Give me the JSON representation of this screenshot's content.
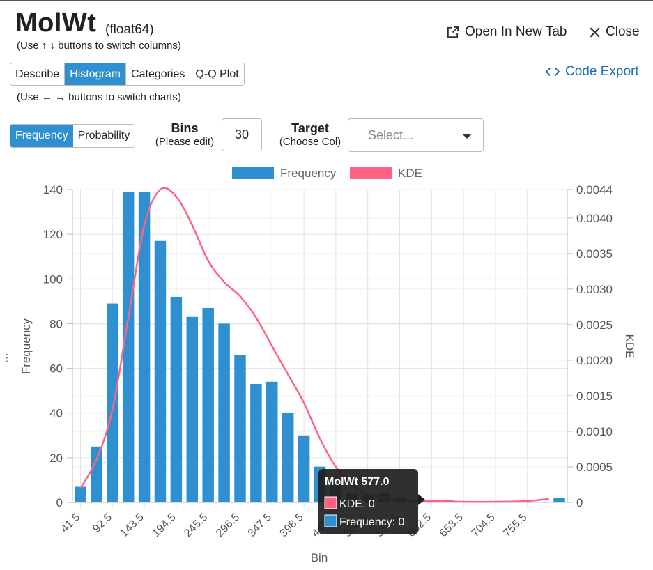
{
  "header": {
    "title": "MolWt",
    "dtype": "(float64)",
    "column_hint": "(Use ↑ ↓ buttons to switch columns)",
    "open_new_tab": "Open In New Tab",
    "close": "Close",
    "code_export": "Code Export"
  },
  "tabs": [
    {
      "label": "Describe",
      "active": false
    },
    {
      "label": "Histogram",
      "active": true
    },
    {
      "label": "Categories",
      "active": false
    },
    {
      "label": "Q-Q Plot",
      "active": false
    }
  ],
  "chart_hint": "(Use ← → buttons to switch charts)",
  "controls": {
    "mode_frequency": "Frequency",
    "mode_probability": "Probability",
    "bins_label": "Bins",
    "bins_sub": "(Please edit)",
    "bins_value": "30",
    "target_label": "Target",
    "target_sub": "(Choose Col)",
    "target_placeholder": "Select..."
  },
  "colors": {
    "accent": "#2e8fd1",
    "bar": "#2e8fd1",
    "kde": "#ff6384",
    "link": "#1f6db5",
    "tooltip_bg": "#1e1e1e"
  },
  "chart_data": {
    "type": "bar",
    "xlabel": "Bin",
    "ylabel": "Frequency",
    "y2label": "KDE",
    "ylim": [
      0,
      140
    ],
    "y2lim": [
      0,
      0.0044
    ],
    "yticks": [
      "0",
      "20",
      "40",
      "60",
      "80",
      "100",
      "120",
      "140"
    ],
    "y2ticks": [
      "0",
      "0.0005",
      "0.0010",
      "0.0015",
      "0.0020",
      "0.0025",
      "0.0030",
      "0.0035",
      "0.0040",
      "0.0044"
    ],
    "tick_labels": [
      "41.5",
      "92.5",
      "143.5",
      "194.5",
      "245.5",
      "296.5",
      "347.5",
      "398.5",
      "449.5",
      "500.5",
      "551.5",
      "602.5",
      "653.5",
      "704.5",
      "755.5"
    ],
    "legend": [
      "Frequency",
      "KDE"
    ],
    "legend_position": "top",
    "grid": true,
    "series": [
      {
        "name": "Frequency",
        "values": [
          7,
          25,
          89,
          139,
          139,
          117,
          92,
          83,
          87,
          80,
          66,
          53,
          54,
          40,
          30,
          16,
          8,
          4,
          3,
          4,
          2,
          1,
          0,
          1,
          0,
          0,
          0,
          0,
          0,
          0,
          2
        ]
      },
      {
        "name": "KDE",
        "x": [
          41.5,
          67,
          92.5,
          118,
          143.5,
          169,
          194.5,
          220,
          245.5,
          271,
          296.5,
          322,
          347.5,
          373,
          398.5,
          424,
          449.5,
          475,
          500.5,
          551.5,
          602.5,
          653.5,
          704.5,
          755.5,
          790
        ],
        "values": [
          0.0002,
          0.0006,
          0.0013,
          0.0026,
          0.0039,
          0.0044,
          0.0043,
          0.0039,
          0.0034,
          0.0031,
          0.0029,
          0.0026,
          0.0022,
          0.0018,
          0.0014,
          0.0009,
          0.0005,
          0.00025,
          0.00012,
          4e-05,
          2e-05,
          1e-05,
          1e-05,
          2e-05,
          5e-05
        ]
      }
    ],
    "tooltip": {
      "title": "MolWt 577.0",
      "kde": "KDE: 0",
      "frequency": "Frequency: 0"
    }
  }
}
